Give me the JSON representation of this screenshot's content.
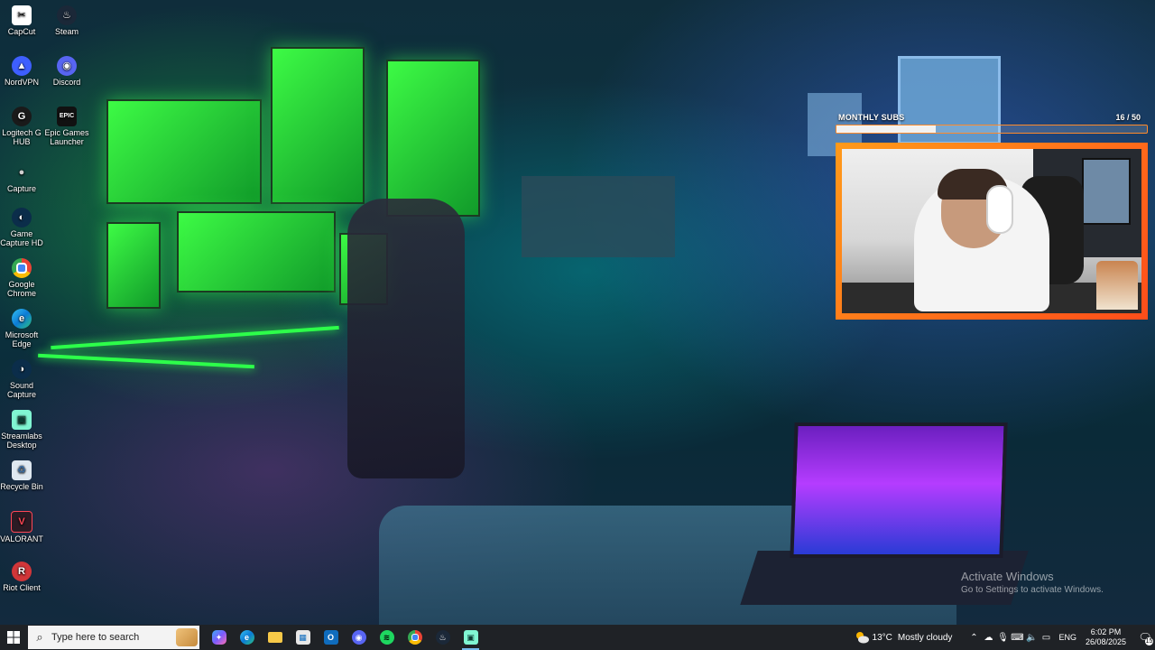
{
  "desktop_icons": [
    {
      "label": "CapCut",
      "icon": "capcut-icon",
      "color": "#ffffff"
    },
    {
      "label": "Steam",
      "icon": "steam-icon",
      "color": "#1b2838"
    },
    {
      "label": "NordVPN",
      "icon": "nordvpn-icon",
      "color": "#3e5fff"
    },
    {
      "label": "Discord",
      "icon": "discord-icon",
      "color": "#5865f2"
    },
    {
      "label": "Logitech G HUB",
      "icon": "logitech-g-hub-icon",
      "color": "#1a1a1a"
    },
    {
      "label": "Epic Games Launcher",
      "icon": "epic-games-icon",
      "color": "#111111",
      "glyph": "EPIC"
    },
    {
      "label": "Capture",
      "icon": "capture-icon",
      "color": "#cfcfcf"
    },
    {
      "label": "Game Capture HD",
      "icon": "game-capture-hd-icon",
      "color": "#0b2d4a"
    },
    {
      "label": "Google Chrome",
      "icon": "chrome-icon",
      "color": "#34a853"
    },
    {
      "label": "Microsoft Edge",
      "icon": "edge-icon",
      "color": "#0c7bd6"
    },
    {
      "label": "Sound Capture",
      "icon": "sound-capture-icon",
      "color": "#0b2d4a"
    },
    {
      "label": "Streamlabs Desktop",
      "icon": "streamlabs-icon",
      "color": "#80f5d2"
    },
    {
      "label": "Recycle Bin",
      "icon": "recycle-bin-icon",
      "color": "#dfe8f0"
    },
    {
      "label": "VALORANT",
      "icon": "valorant-icon",
      "color": "#ff4655"
    },
    {
      "label": "Riot Client",
      "icon": "riot-client-icon",
      "color": "#d13639"
    }
  ],
  "subs_widget": {
    "title": "MONTHLY SUBS",
    "current": "16",
    "separator": " / ",
    "goal": "50",
    "fraction": 0.32
  },
  "watermark": {
    "line1": "Activate Windows",
    "line2": "Go to Settings to activate Windows."
  },
  "taskbar": {
    "search_placeholder": "Type here to search",
    "apps": [
      {
        "name": "copilot",
        "icon": "copilot-icon",
        "color": "#7b5cff",
        "active": false
      },
      {
        "name": "edge",
        "icon": "edge-icon",
        "color": "#0c7bd6",
        "active": false
      },
      {
        "name": "file-explorer",
        "icon": "folder-icon",
        "color": "#f7c948",
        "active": false
      },
      {
        "name": "microsoft-store",
        "icon": "store-icon",
        "color": "#e8e8e8",
        "active": false
      },
      {
        "name": "outlook",
        "icon": "outlook-icon",
        "color": "#0f6cbd",
        "active": false
      },
      {
        "name": "discord",
        "icon": "discord-icon",
        "color": "#5865f2",
        "active": false
      },
      {
        "name": "spotify",
        "icon": "spotify-icon",
        "color": "#1ed760",
        "active": false
      },
      {
        "name": "chrome",
        "icon": "chrome-icon",
        "color": "#34a853",
        "active": false
      },
      {
        "name": "steam",
        "icon": "steam-icon",
        "color": "#1b2838",
        "active": false
      },
      {
        "name": "streamlabs",
        "icon": "streamlabs-icon",
        "color": "#80f5d2",
        "active": true
      }
    ],
    "weather": {
      "temp": "13°C",
      "condition": "Mostly cloudy"
    },
    "language": "ENG",
    "time": "6:02 PM",
    "date": "26/08/2025",
    "notification_count": "15"
  }
}
